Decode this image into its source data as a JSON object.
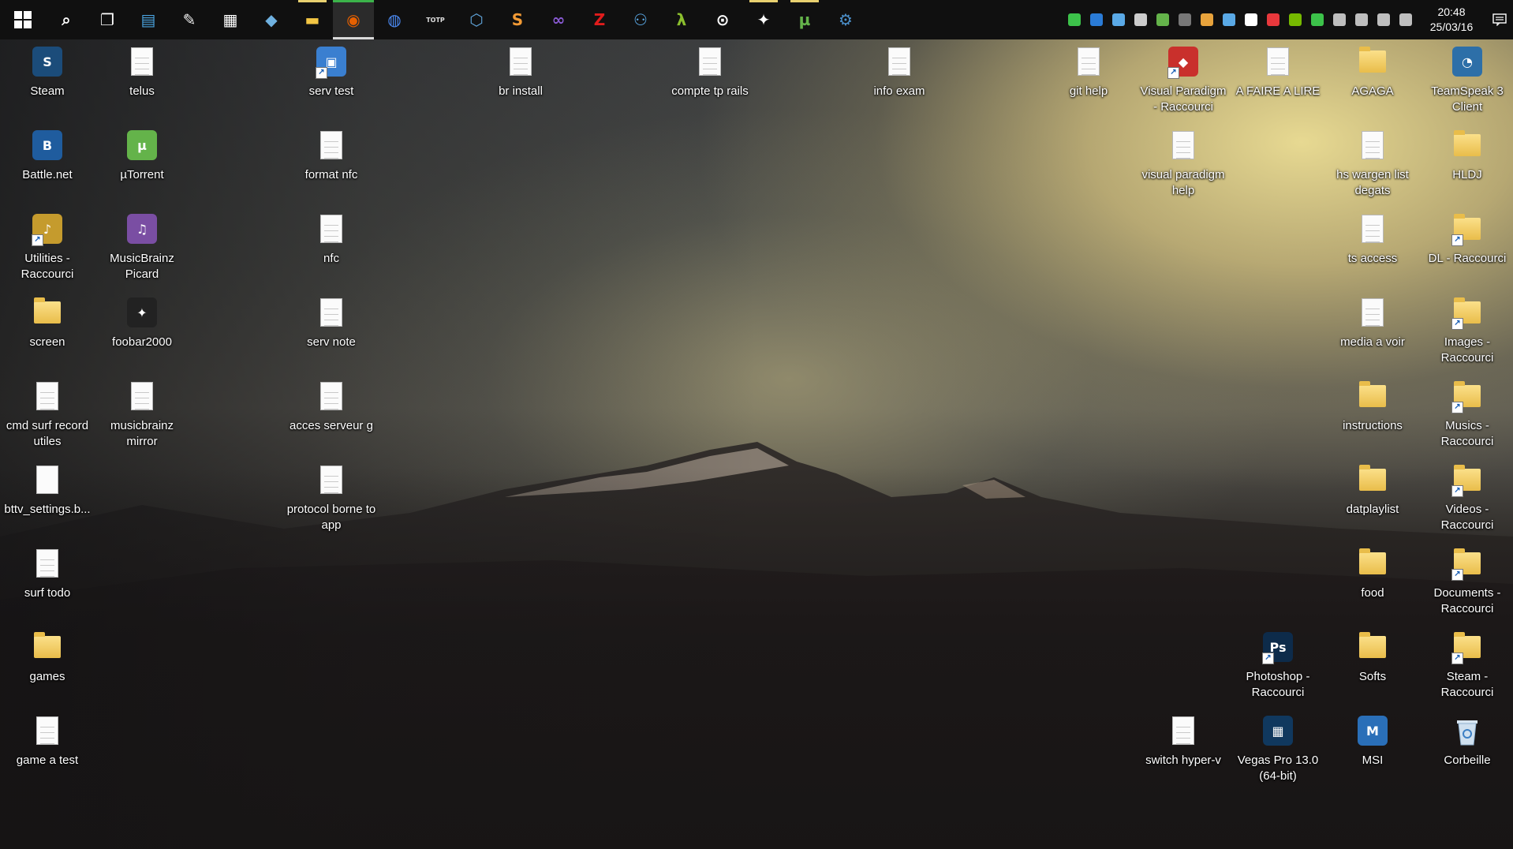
{
  "taskbar": {
    "pinned": [
      {
        "name": "search-icon",
        "glyph": "⌕",
        "color": "#ffffff"
      },
      {
        "name": "task-view-icon",
        "glyph": "❐",
        "color": "#ffffff"
      },
      {
        "name": "control-panel-icon",
        "glyph": "▤",
        "color": "#4aa3df"
      },
      {
        "name": "paint-icon",
        "glyph": "✎",
        "color": "#f0f0f0"
      },
      {
        "name": "calculator-icon",
        "glyph": "▦",
        "color": "#ffffff"
      },
      {
        "name": "notepad-icon",
        "glyph": "◆",
        "color": "#6fb1e0"
      },
      {
        "name": "file-explorer-icon",
        "glyph": "▬",
        "color": "#f3c644"
      },
      {
        "name": "firefox-icon",
        "glyph": "◉",
        "color": "#e66000"
      },
      {
        "name": "chrome-icon",
        "glyph": "◍",
        "color": "#4c8bf5"
      },
      {
        "name": "totp-icon",
        "glyph": "TOTP",
        "color": "#dddddd"
      },
      {
        "name": "virtualbox-icon",
        "glyph": "⬡",
        "color": "#5fa3d8"
      },
      {
        "name": "sublime-text-icon",
        "glyph": "S",
        "color": "#f29a35"
      },
      {
        "name": "visual-studio-icon",
        "glyph": "∞",
        "color": "#8a5bd4"
      },
      {
        "name": "filezilla-icon",
        "glyph": "Z",
        "color": "#e01c1c"
      },
      {
        "name": "network-icon",
        "glyph": "⚇",
        "color": "#5aa9e6"
      },
      {
        "name": "lambda-icon",
        "glyph": "λ",
        "color": "#8bbf2e"
      },
      {
        "name": "media-icon",
        "glyph": "⊙",
        "color": "#ffffff"
      },
      {
        "name": "foobar2000-icon",
        "glyph": "✦",
        "color": "#ffffff"
      },
      {
        "name": "utorrent-icon",
        "glyph": "µ",
        "color": "#64b34a"
      },
      {
        "name": "steam-icon",
        "glyph": "⚙",
        "color": "#4b8fc9"
      }
    ],
    "tray_colors": [
      "#3cc24a",
      "#2a7bd6",
      "#5aa9e6",
      "#cccccc",
      "#64b34a",
      "#777777",
      "#e8a33c",
      "#5aa9e6",
      "#ffffff",
      "#e8383c",
      "#76b900",
      "#3cc24a",
      "#dddddd",
      "#dddddd",
      "#dddddd",
      "#dddddd"
    ],
    "clock": {
      "time": "20:48",
      "date": "25/03/16"
    }
  },
  "desktop": {
    "icons": [
      {
        "label": "Steam",
        "type": "app",
        "badge_color": "#1b4c7a",
        "badge_text": "S"
      },
      {
        "label": "telus",
        "type": "doc"
      },
      {
        "label": "serv test",
        "type": "app",
        "badge_color": "#3a7fd0",
        "badge_text": "▣"
      },
      {
        "label": "br install",
        "type": "doc"
      },
      {
        "label": "compte tp rails",
        "type": "doc"
      },
      {
        "label": "info exam",
        "type": "doc"
      },
      {
        "label": "git help",
        "type": "doc"
      },
      {
        "label": "Visual Paradigm - Raccourci",
        "type": "app",
        "badge_color": "#c9302c",
        "badge_text": "◆"
      },
      {
        "label": "A FAIRE A LIRE",
        "type": "doc"
      },
      {
        "label": "AGAGA",
        "type": "folder"
      },
      {
        "label": "TeamSpeak 3 Client",
        "type": "app",
        "badge_color": "#2d6fa8",
        "badge_text": "◔"
      },
      {
        "label": "Battle.net",
        "type": "app",
        "badge_color": "#1f5c9e",
        "badge_text": "B"
      },
      {
        "label": "µTorrent",
        "type": "app",
        "badge_color": "#64b34a",
        "badge_text": "µ"
      },
      {
        "label": "format nfc",
        "type": "doc"
      },
      {
        "label": "visual paradigm help",
        "type": "doc"
      },
      {
        "label": "hs wargen list degats",
        "type": "doc"
      },
      {
        "label": "HLDJ",
        "type": "folder"
      },
      {
        "label": "Utilities - Raccourci",
        "type": "app",
        "badge_color": "#c59b2d",
        "badge_text": "♪"
      },
      {
        "label": "MusicBrainz Picard",
        "type": "app",
        "badge_color": "#7a4ea3",
        "badge_text": "♫"
      },
      {
        "label": "nfc",
        "type": "doc"
      },
      {
        "label": "ts access",
        "type": "doc"
      },
      {
        "label": "DL - Raccourci",
        "type": "folder"
      },
      {
        "label": "screen",
        "type": "folder"
      },
      {
        "label": "foobar2000",
        "type": "app",
        "badge_color": "#222222",
        "badge_text": "✦"
      },
      {
        "label": "serv note",
        "type": "doc"
      },
      {
        "label": "media a voir",
        "type": "doc"
      },
      {
        "label": "Images - Raccourci",
        "type": "folder"
      },
      {
        "label": "cmd surf record utiles",
        "type": "doc"
      },
      {
        "label": "musicbrainz mirror",
        "type": "doc"
      },
      {
        "label": "acces serveur g",
        "type": "doc"
      },
      {
        "label": "instructions",
        "type": "folder"
      },
      {
        "label": "Musics - Raccourci",
        "type": "folder"
      },
      {
        "label": "bttv_settings.b...",
        "type": "blank"
      },
      {
        "label": "protocol borne to app",
        "type": "doc"
      },
      {
        "label": "datplaylist",
        "type": "folder"
      },
      {
        "label": "Videos - Raccourci",
        "type": "folder"
      },
      {
        "label": "surf todo",
        "type": "doc"
      },
      {
        "label": "food",
        "type": "folder"
      },
      {
        "label": "Documents - Raccourci",
        "type": "folder"
      },
      {
        "label": "games",
        "type": "folder"
      },
      {
        "label": "Photoshop - Raccourci",
        "type": "app",
        "badge_color": "#0d2b4a",
        "badge_text": "Ps"
      },
      {
        "label": "Softs",
        "type": "folder"
      },
      {
        "label": "Steam - Raccourci",
        "type": "folder"
      },
      {
        "label": "game a test",
        "type": "doc"
      },
      {
        "label": "switch hyper-v",
        "type": "doc"
      },
      {
        "label": "Vegas Pro 13.0 (64-bit)",
        "type": "app",
        "badge_color": "#10385e",
        "badge_text": "▦"
      },
      {
        "label": "MSI",
        "type": "app",
        "badge_color": "#2a6fb8",
        "badge_text": "M"
      },
      {
        "label": "Corbeille",
        "type": "bin"
      }
    ]
  }
}
